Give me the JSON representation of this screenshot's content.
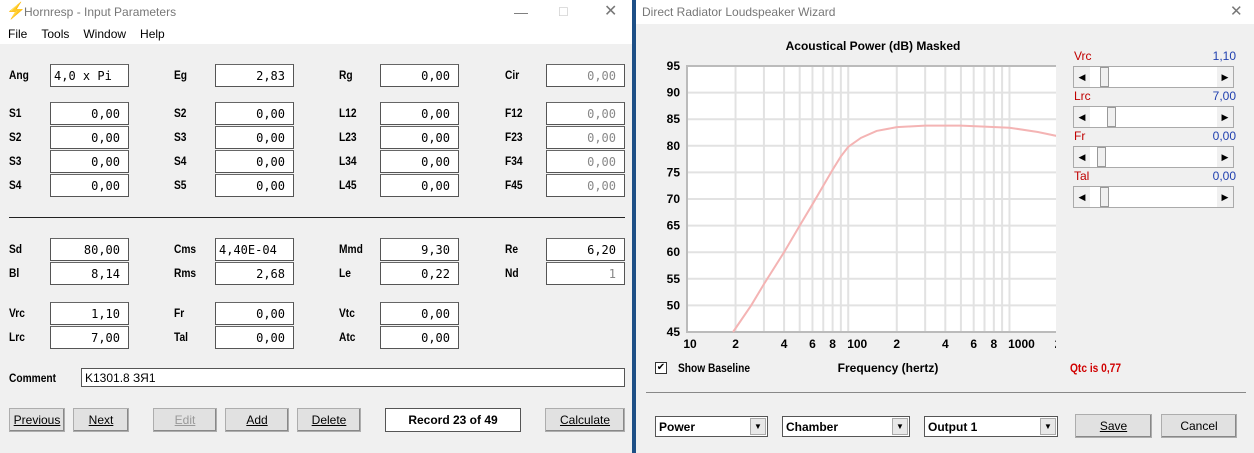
{
  "left_window": {
    "title": "Hornresp - Input Parameters",
    "menu": [
      "File",
      "Tools",
      "Window",
      "Help"
    ],
    "rows": [
      [
        {
          "label": "Ang",
          "value": "4,0 x Pi",
          "align": "left"
        },
        {
          "label": "Eg",
          "value": "2,83"
        },
        {
          "label": "Rg",
          "value": "0,00"
        },
        {
          "label": "Cir",
          "value": "0,00",
          "disabled": true
        }
      ],
      [
        {
          "label": "S1",
          "value": "0,00"
        },
        {
          "label": "S2",
          "value": "0,00"
        },
        {
          "label": "L12",
          "value": "0,00"
        },
        {
          "label": "F12",
          "value": "0,00",
          "disabled": true
        }
      ],
      [
        {
          "label": "S2",
          "value": "0,00"
        },
        {
          "label": "S3",
          "value": "0,00"
        },
        {
          "label": "L23",
          "value": "0,00"
        },
        {
          "label": "F23",
          "value": "0,00",
          "disabled": true
        }
      ],
      [
        {
          "label": "S3",
          "value": "0,00"
        },
        {
          "label": "S4",
          "value": "0,00"
        },
        {
          "label": "L34",
          "value": "0,00"
        },
        {
          "label": "F34",
          "value": "0,00",
          "disabled": true
        }
      ],
      [
        {
          "label": "S4",
          "value": "0,00"
        },
        {
          "label": "S5",
          "value": "0,00"
        },
        {
          "label": "L45",
          "value": "0,00"
        },
        {
          "label": "F45",
          "value": "0,00",
          "disabled": true
        }
      ],
      [
        {
          "label": "Sd",
          "value": "80,00"
        },
        {
          "label": "Cms",
          "value": "4,40E-04",
          "align": "left"
        },
        {
          "label": "Mmd",
          "value": "9,30"
        },
        {
          "label": "Re",
          "value": "6,20"
        }
      ],
      [
        {
          "label": "Bl",
          "value": "8,14"
        },
        {
          "label": "Rms",
          "value": "2,68"
        },
        {
          "label": "Le",
          "value": "0,22"
        },
        {
          "label": "Nd",
          "value": "1",
          "disabled": true
        }
      ],
      [
        {
          "label": "Vrc",
          "value": "1,10"
        },
        {
          "label": "Fr",
          "value": "0,00"
        },
        {
          "label": "Vtc",
          "value": "0,00"
        }
      ],
      [
        {
          "label": "Lrc",
          "value": "7,00"
        },
        {
          "label": "Tal",
          "value": "0,00"
        },
        {
          "label": "Atc",
          "value": "0,00"
        }
      ]
    ],
    "comment_label": "Comment",
    "comment_value": "K1301.8 ЗЯ1",
    "buttons": {
      "previous": "Previous",
      "next": "Next",
      "edit": "Edit",
      "add": "Add",
      "delete": "Delete",
      "calculate": "Calculate"
    },
    "record": "Record 23 of 49"
  },
  "right_window": {
    "title": "Direct Radiator Loudspeaker Wizard",
    "sliders": [
      {
        "label": "Vrc",
        "value": "1,10",
        "position": 0.08
      },
      {
        "label": "Lrc",
        "value": "7,00",
        "position": 0.14
      },
      {
        "label": "Fr",
        "value": "0,00",
        "position": 0.06
      },
      {
        "label": "Tal",
        "value": "0,00",
        "position": 0.08
      }
    ],
    "show_baseline": "Show Baseline",
    "show_baseline_checked": true,
    "qtc": "Qtc is 0,77",
    "dropdowns": [
      "Power",
      "Chamber",
      "Output 1"
    ],
    "save": "Save",
    "cancel": "Cancel"
  },
  "chart_data": {
    "type": "line",
    "title": "Acoustical Power (dB)   Masked",
    "xlabel": "Frequency (hertz)",
    "ylabel": "",
    "xscale": "log",
    "xlim": [
      10,
      2000
    ],
    "ylim": [
      45,
      95
    ],
    "yticks": [
      45,
      50,
      55,
      60,
      65,
      70,
      75,
      80,
      85,
      90,
      95
    ],
    "xticks": [
      {
        "v": 10,
        "t": "10"
      },
      {
        "v": 20,
        "t": "2"
      },
      {
        "v": 40,
        "t": "4"
      },
      {
        "v": 60,
        "t": "6"
      },
      {
        "v": 80,
        "t": "8"
      },
      {
        "v": 100,
        "t": "100"
      },
      {
        "v": 200,
        "t": "2"
      },
      {
        "v": 400,
        "t": "4"
      },
      {
        "v": 600,
        "t": "6"
      },
      {
        "v": 800,
        "t": "8"
      },
      {
        "v": 1000,
        "t": "1000"
      },
      {
        "v": 2000,
        "t": "2"
      }
    ],
    "grid": true,
    "series": [
      {
        "name": "Power",
        "color": "#f4b4b4",
        "x": [
          19.3,
          25,
          30,
          40,
          50,
          60,
          70,
          80,
          90,
          100,
          120,
          150,
          200,
          300,
          500,
          700,
          1000,
          1500,
          2000
        ],
        "y": [
          45,
          50,
          54,
          60,
          65,
          69,
          72.5,
          75.5,
          78,
          79.8,
          81.5,
          82.8,
          83.5,
          83.8,
          83.8,
          83.6,
          83.4,
          82.6,
          81.8
        ]
      }
    ]
  }
}
